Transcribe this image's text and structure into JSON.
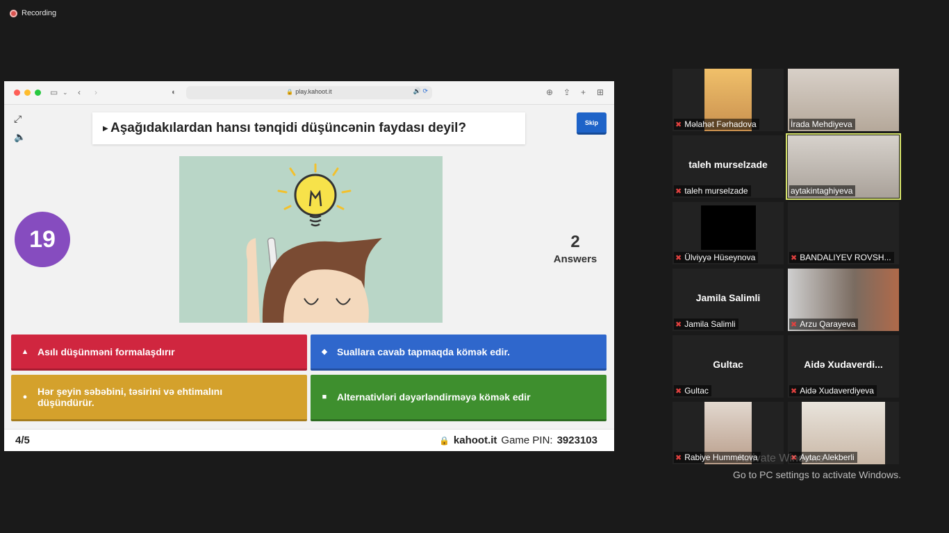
{
  "recording": {
    "label": "Recording"
  },
  "browser": {
    "url": "play.kahoot.it"
  },
  "game": {
    "question": "Aşağıdakılardan hansı tənqidi düşüncənin faydası deyil?",
    "skip_label": "Skip",
    "timer": "19",
    "answers_count": "2",
    "answers_label": "Answers",
    "answers": [
      {
        "text": "Asılı düşünməni formalaşdırır",
        "shape": "▲",
        "color": "#d0263f"
      },
      {
        "text": "Suallara cavab tapmaqda kömək edir.",
        "shape": "◆",
        "color": "#2f67cc"
      },
      {
        "text": "Hər şeyin səbəbini, təsirini və ehtimalını düşündürür.",
        "shape": "●",
        "color": "#d4a12c"
      },
      {
        "text": "Alternativləri dəyərləndirməyə kömək edir",
        "shape": "■",
        "color": "#3e8f2e"
      }
    ],
    "progress": "4/5",
    "site": "kahoot.it",
    "pin_label": "Game PIN:",
    "pin": "3923103"
  },
  "participants": [
    {
      "name": "Məlahət Fərhadova"
    },
    {
      "name": "İrada Mehdiyeva"
    },
    {
      "name": "taleh murselzade",
      "display": "taleh murselzade"
    },
    {
      "name": "aytakintaghiyeva"
    },
    {
      "name": "Ülviyyə Hüseynova"
    },
    {
      "name": "BANDALIYEV ROVSH..."
    },
    {
      "name": "Jamila Salimli",
      "display": "Jamila Salimli"
    },
    {
      "name": "Arzu Qarayeva"
    },
    {
      "name": "Gultac",
      "display": "Gultac"
    },
    {
      "name": "Aidə Xudaverdiyeva",
      "display": "Aidə Xudaverdi..."
    },
    {
      "name": "Rabiye Hummetova"
    },
    {
      "name": "Aytac Alekberli"
    }
  ],
  "watermark": {
    "title": "Activate Windows",
    "subtitle": "Go to PC settings to activate Windows."
  }
}
